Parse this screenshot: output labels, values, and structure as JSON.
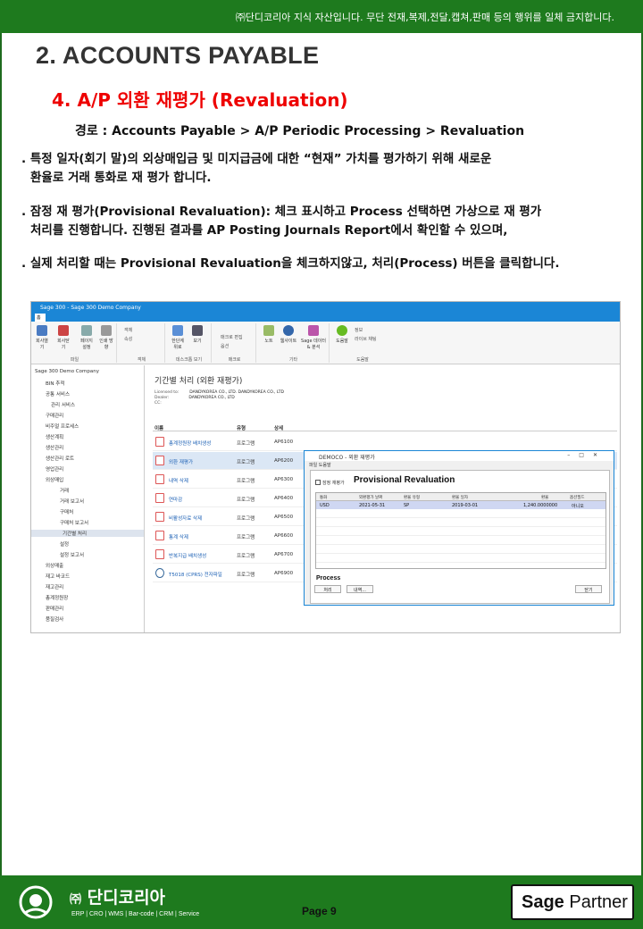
{
  "header": {
    "notice": "㈜단디코리아 지식 자산입니다. 무단 전재,복제,전달,캡쳐,판매 등의 행위를 일체 금지합니다."
  },
  "main_title": "2. ACCOUNTS PAYABLE",
  "sub_title": "4. A/P 외환 재평가 (Revaluation)",
  "path": "경로 : Accounts Payable > A/P Periodic Processing > Revaluation",
  "paragraphs": [
    {
      "line1": ". 특정 일자(회기 말)의 외상매입금 및 미지급금에 대한 “현재” 가치를 평가하기 위해 새로운",
      "line2": "환율로 거래 통화로 재 평가 합니다."
    },
    {
      "line1": ". 잠정 재 평가(Provisional Revaluation): 체크 표시하고 Process 선택하면 가상으로 재 평가",
      "line2": "처리를 진행합니다. 진행된 결과를 AP Posting Journals Report에서 확인할 수 있으며,"
    },
    {
      "line1": ". 실제 처리할 때는 Provisional Revaluation을 체크하지않고, 처리(Process) 버튼을 클릭합니다."
    }
  ],
  "screenshot": {
    "window_title": "Sage 300 - Sage 300 Demo Company",
    "tab": "홈",
    "ribbon": {
      "buttons": [
        "회사열기",
        "회사닫기",
        "페이지 설정",
        "인쇄 방향"
      ],
      "group_file": "파일",
      "group_item": "객체",
      "group_desktop": "데스크톱 보기",
      "group_macro": "매크로",
      "group_etc": "기타",
      "group_help": "도움말",
      "view_btn1": "한단계 위로",
      "view_btn2": "보기",
      "macro1": "매크로 편집",
      "macro2": "옵션",
      "etc1": "노트",
      "etc2": "웹사이트",
      "etc3": "Sage 데이터 & 분석",
      "help1": "도움말",
      "help2": "정보",
      "help3": "라이브 채팅",
      "obj1": "객체",
      "obj2": "속성"
    },
    "tree": [
      "Sage 300 Demo Company",
      "BIN 추적",
      "공통 서비스",
      "관리 서비스",
      "구매관리",
      "비주얼 프로세스",
      "생산계획",
      "생산관리",
      "생산관리 로트",
      "영업관리",
      "외상매입",
      "거래",
      "거래 보고서",
      "구매처",
      "구매처 보고서",
      "기간별 처리",
      "설정",
      "설정 보고서",
      "외상매출",
      "재고 바코드",
      "재고관리",
      "총계정원장",
      "판매관리",
      "품질검사"
    ],
    "content_title": "기간별 처리 (외환 재평가)",
    "license": {
      "licensed_label": "Licensed to:",
      "licensed_value": "DANDYKOREA CO., LTD. DANDYKOREA CO., LTD",
      "dealer_label": "Dealer:",
      "dealer_value": "DANDYKOREA CO., LTD",
      "cc_label": "CC:"
    },
    "table_headers": [
      "이름",
      "유형",
      "상세"
    ],
    "rows": [
      {
        "name": "총계정원장 배치생성",
        "type": "프로그램",
        "code": "AP6100"
      },
      {
        "name": "외환 재평가",
        "type": "프로그램",
        "code": "AP6200"
      },
      {
        "name": "내역 삭제",
        "type": "프로그램",
        "code": "AP6300"
      },
      {
        "name": "연마감",
        "type": "프로그램",
        "code": "AP6400"
      },
      {
        "name": "비활성자료 삭제",
        "type": "프로그램",
        "code": "AP6500"
      },
      {
        "name": "통계 삭제",
        "type": "프로그램",
        "code": "AP6600"
      },
      {
        "name": "반복지급 배치생성",
        "type": "프로그램",
        "code": "AP6700"
      },
      {
        "name": "T5018 (CPRS) 전자파일",
        "type": "프로그램",
        "code": "AP6900"
      }
    ],
    "dialog": {
      "title": "DEMOCO - 외환 재평가",
      "menu": "파일  도움말",
      "checkbox_label": "잠정 재평가",
      "provisional_label": "Provisional Revaluation",
      "grid_headers": [
        "통화",
        "외환평가 날짜",
        "환율 유형",
        "환율 일자",
        "환율",
        "옵션필드"
      ],
      "grid_row": [
        "USD",
        "2021-05-31",
        "SP",
        "2019-03-01",
        "1,240.0000000",
        "아니오"
      ],
      "process_label": "Process",
      "btn_process": "처리",
      "btn_history": "내역...",
      "btn_close": "닫기"
    }
  },
  "footer": {
    "company_prefix": "㈜",
    "company": "단디코리아",
    "tagline": "ERP | CRO | WMS | Bar-code | CRM | Service",
    "page": "Page  9",
    "partner_bold": "Sage",
    "partner_rest": " Partner"
  }
}
